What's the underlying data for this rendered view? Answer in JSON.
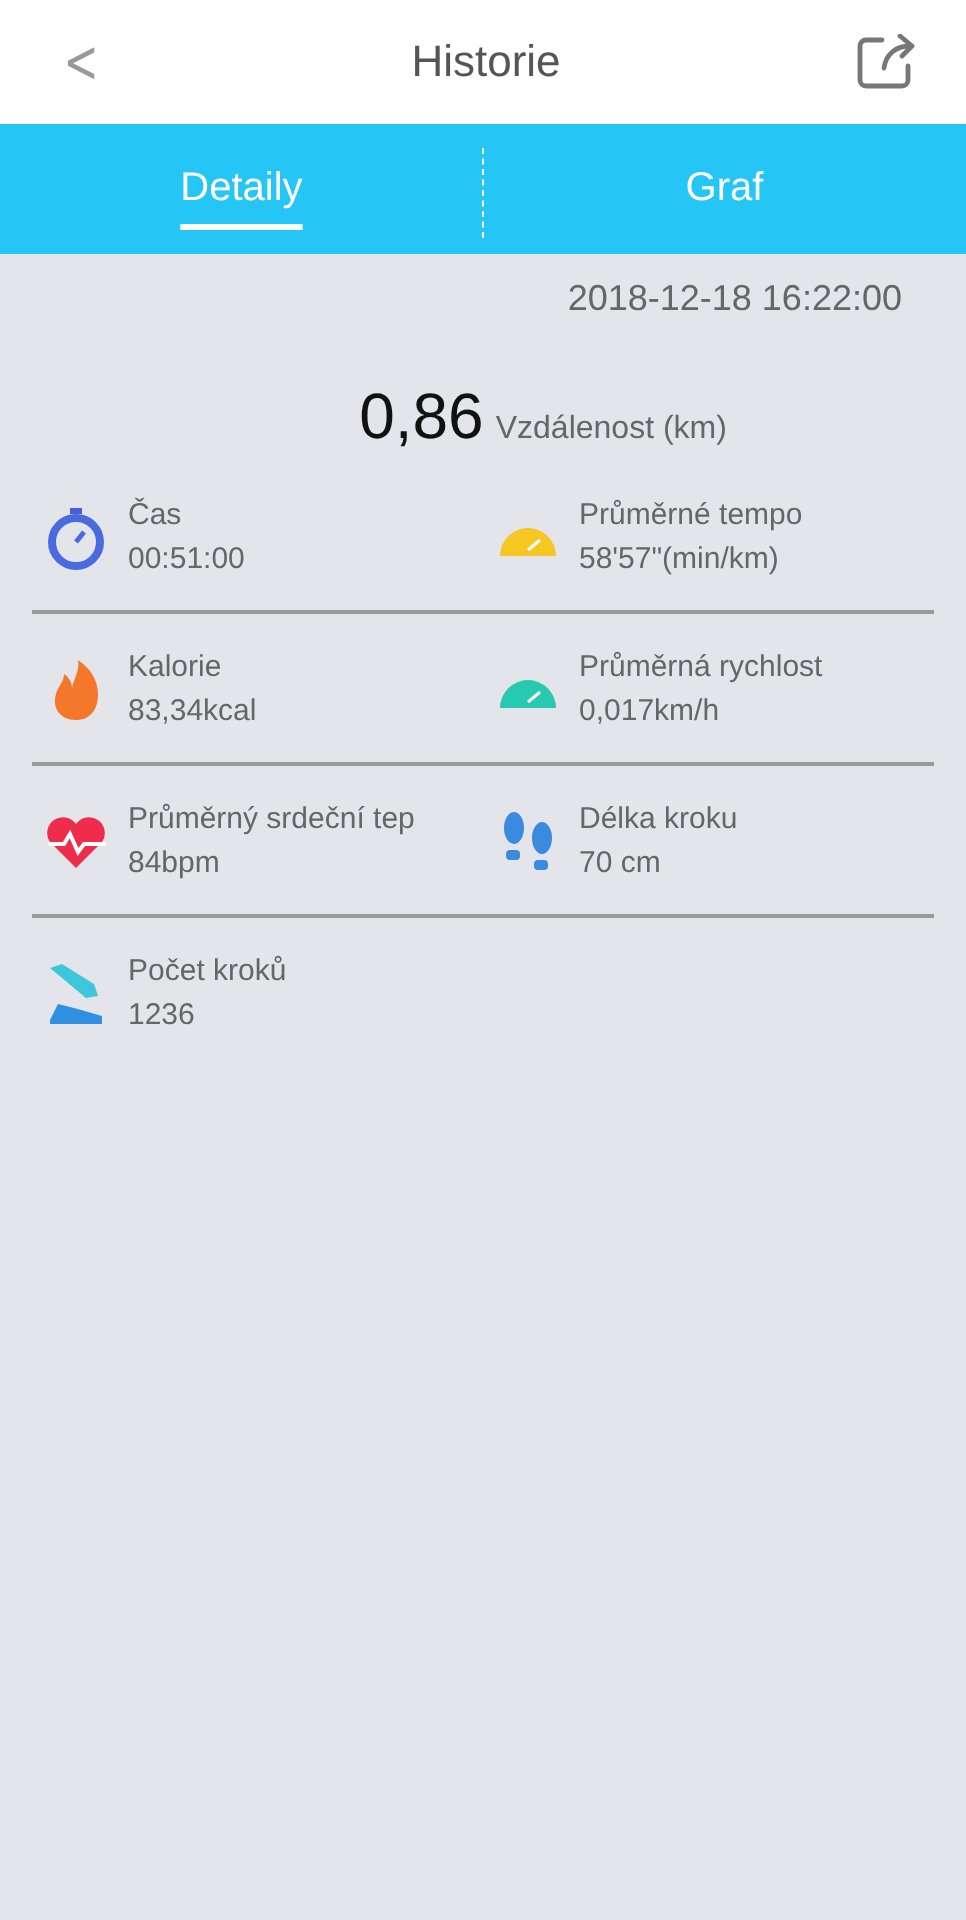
{
  "header": {
    "back": "<",
    "title": "Historie"
  },
  "tabs": [
    {
      "label": "Detaily",
      "selected": true
    },
    {
      "label": "Graf",
      "selected": false
    }
  ],
  "date": "2018-12-18 16:22:00",
  "distance": {
    "value": "0,86",
    "label": "Vzdálenost (km)"
  },
  "metrics": [
    {
      "kind": "stopwatch",
      "label": "Čas",
      "value": "00:51:00"
    },
    {
      "kind": "pace",
      "label": "Průměrné tempo",
      "value": "58'57\"(min/km)"
    },
    {
      "kind": "flame",
      "label": "Kalorie",
      "value": "83,34kcal"
    },
    {
      "kind": "speed",
      "label": "Průměrná rychlost",
      "value": "0,017km/h"
    },
    {
      "kind": "heart",
      "label": "Průměrný srdeční tep",
      "value": "84bpm"
    },
    {
      "kind": "footprints",
      "label": "Délka kroku",
      "value": "70 cm"
    },
    {
      "kind": "shoe",
      "label": "Počet kroků",
      "value": "1236"
    }
  ]
}
